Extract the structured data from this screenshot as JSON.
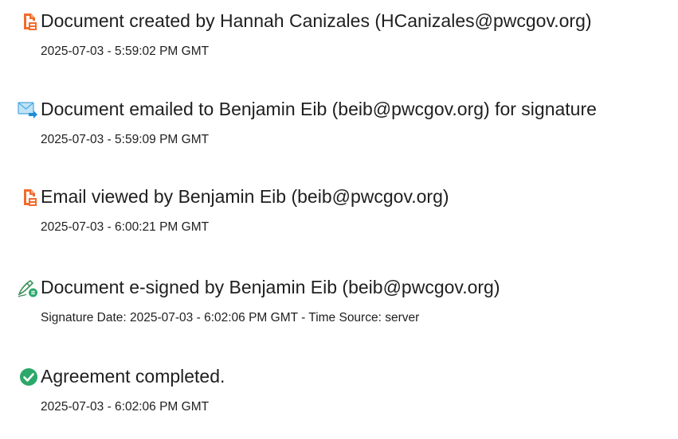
{
  "events": [
    {
      "icon": "document-created-icon",
      "title": "Document created by Hannah Canizales (HCanizales@pwcgov.org)",
      "subtitle": "2025-07-03 - 5:59:02 PM GMT"
    },
    {
      "icon": "email-sent-icon",
      "title": "Document emailed to Benjamin Eib (beib@pwcgov.org) for signature",
      "subtitle": "2025-07-03 - 5:59:09 PM GMT"
    },
    {
      "icon": "document-viewed-icon",
      "title": "Email viewed by Benjamin Eib (beib@pwcgov.org)",
      "subtitle": "2025-07-03 - 6:00:21 PM GMT"
    },
    {
      "icon": "e-sign-pen-icon",
      "title": "Document e-signed by Benjamin Eib (beib@pwcgov.org)",
      "subtitle": "Signature Date: 2025-07-03 - 6:02:06 PM GMT - Time Source: server"
    },
    {
      "icon": "checkmark-circle-icon",
      "title": "Agreement completed.",
      "subtitle": "2025-07-03 - 6:02:06 PM GMT"
    }
  ],
  "colors": {
    "document_icon": "#f26b2b",
    "email_icon_envelope": "#bfe3f7",
    "email_icon_arrow": "#1f8ed6",
    "pen_icon": "#3c8f5a",
    "pen_badge": "#2ba86a",
    "check_icon": "#2ba86a"
  }
}
